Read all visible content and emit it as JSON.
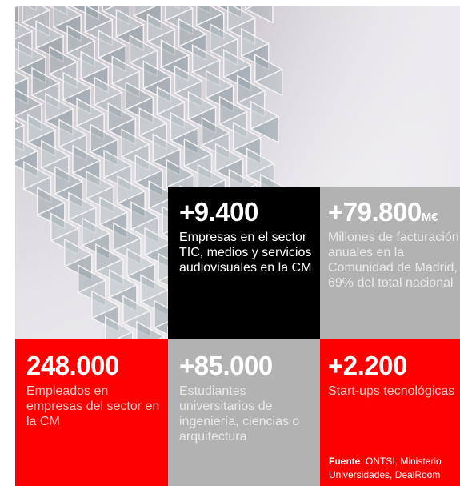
{
  "stats": [
    {
      "value": "+9.400",
      "description": "Empresas en el sector TIC, medios y servicios audiovisuales en la CM"
    },
    {
      "value": "+79.800",
      "unit": "M€",
      "description": "Millones de facturación anuales en la Comunidad de Madrid, 69% del total nacional"
    },
    {
      "value": "248.000",
      "description": "Empleados en empresas del sector en la CM"
    },
    {
      "value": "+85.000",
      "description": "Estudiantes universitarios de ingeniería, ciencias o arquitectura"
    },
    {
      "value": "+2.200",
      "description": "Start-ups tecnológicas"
    }
  ],
  "source": {
    "label": "Fuente",
    "text": ": ONTSI, Ministerio",
    "text_line2": "Universidades, DealRoom"
  },
  "colors": {
    "red": "#ff0000",
    "black": "#000000",
    "gray": "#b2b2b2"
  }
}
